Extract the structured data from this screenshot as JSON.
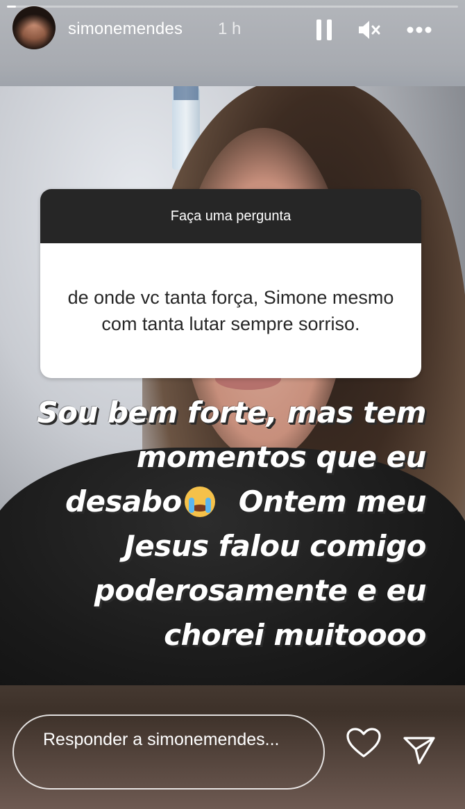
{
  "story": {
    "progress_fraction": 0.02
  },
  "header": {
    "username": "simonemendes",
    "time": "1 h",
    "icons": [
      "pause-icon",
      "mute-icon",
      "more-icon"
    ]
  },
  "question_sticker": {
    "title": "Faça uma pergunta",
    "question": "de onde vc tanta força, Simone mesmo com tanta lutar sempre sorriso."
  },
  "caption": {
    "line1": "Sou bem forte, mas tem",
    "line2": "momentos que eu",
    "line3a": "desabo",
    "line3b": "Ontem meu",
    "line4": "Jesus falou comigo",
    "line5": "poderosamente e eu",
    "line6": "chorei muitoooo",
    "emoji": "crying-face-emoji"
  },
  "footer": {
    "reply_placeholder": "Responder a simonemendes...",
    "icons": [
      "heart-icon",
      "send-icon"
    ]
  }
}
